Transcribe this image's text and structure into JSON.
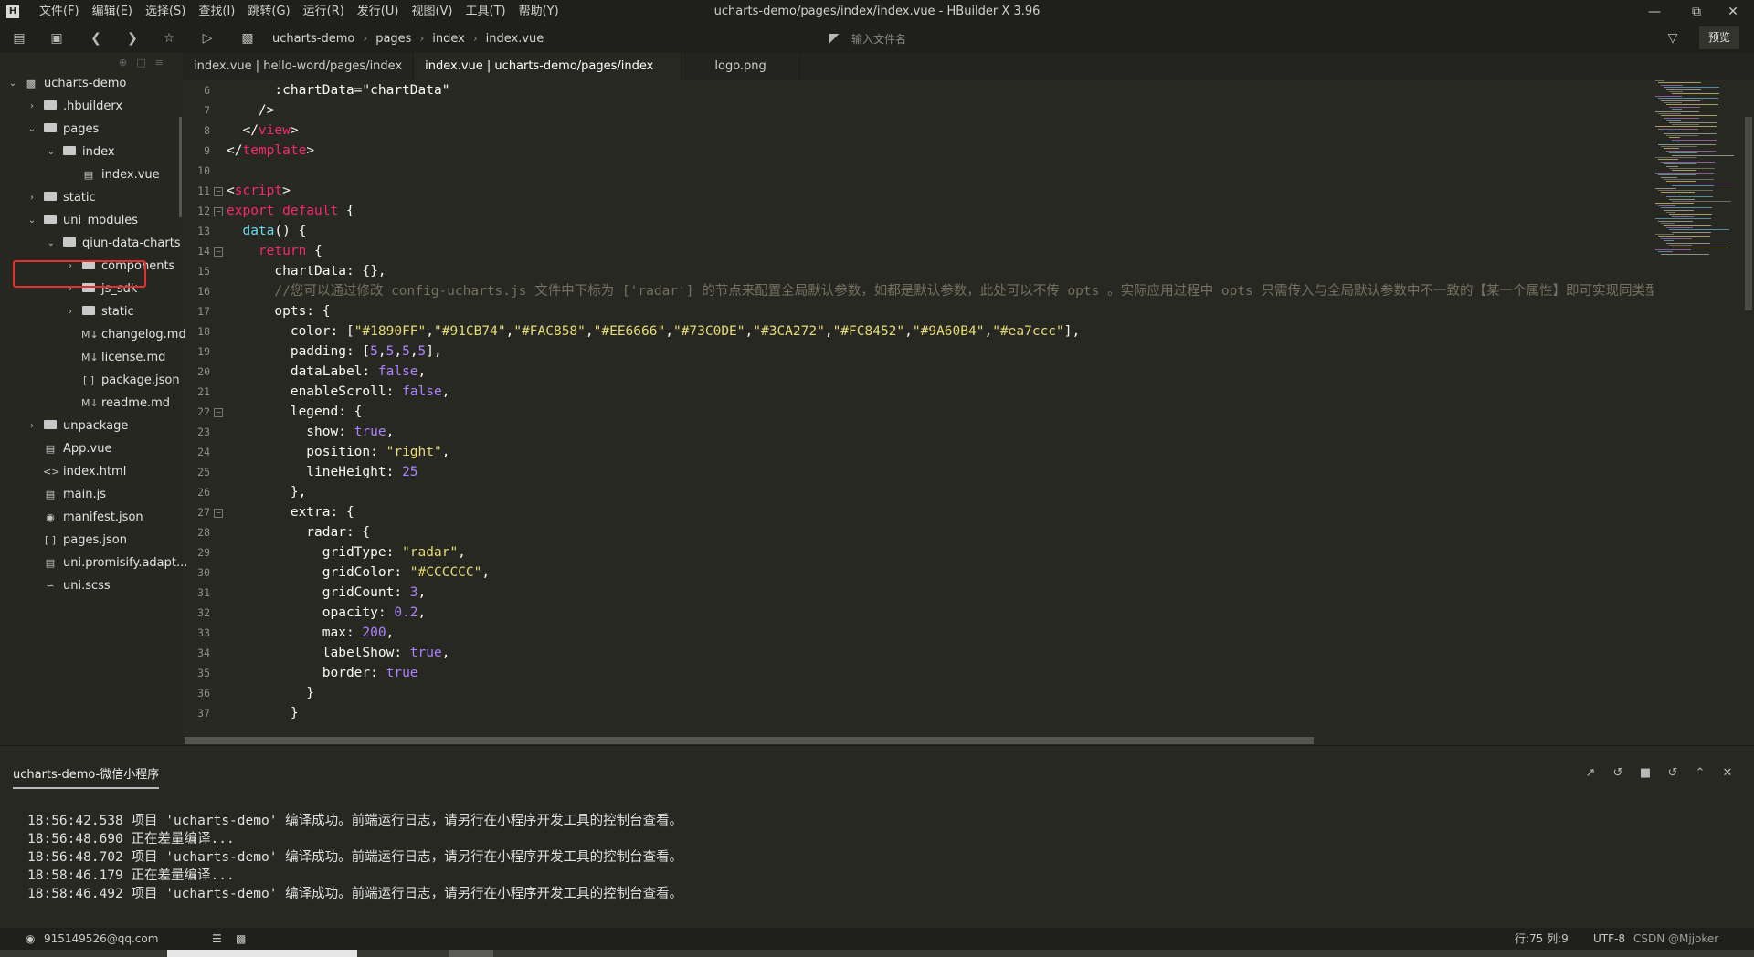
{
  "window": {
    "title": "ucharts-demo/pages/index/index.vue - HBuilder X 3.96",
    "app_logo": "H"
  },
  "menu": [
    "文件(F)",
    "编辑(E)",
    "选择(S)",
    "查找(I)",
    "跳转(G)",
    "运行(R)",
    "发行(U)",
    "视图(V)",
    "工具(T)",
    "帮助(Y)"
  ],
  "breadcrumb": {
    "project": "ucharts-demo",
    "folder": "pages",
    "subfolder": "index",
    "file": "index.vue"
  },
  "search": {
    "placeholder": "输入文件名"
  },
  "preview_label": "预览",
  "tabs": [
    "index.vue | hello-word/pages/index",
    "index.vue | ucharts-demo/pages/index",
    "logo.png"
  ],
  "tree": [
    {
      "label": "ucharts-demo",
      "icon": "project-icon",
      "arrow": "down"
    },
    {
      "label": ".hbuilderx",
      "icon": "folder-icon",
      "arrow": "right"
    },
    {
      "label": "pages",
      "icon": "folder-open-icon",
      "arrow": "down"
    },
    {
      "label": "index",
      "icon": "folder-open-icon",
      "arrow": "down"
    },
    {
      "label": "index.vue",
      "icon": "vue-file-icon",
      "arrow": ""
    },
    {
      "label": "static",
      "icon": "folder-icon",
      "arrow": "right"
    },
    {
      "label": "uni_modules",
      "icon": "folder-open-icon",
      "arrow": "down",
      "highlighted": true
    },
    {
      "label": "qiun-data-charts",
      "icon": "folder-open-icon",
      "arrow": "down"
    },
    {
      "label": "components",
      "icon": "folder-icon",
      "arrow": "right"
    },
    {
      "label": "js_sdk",
      "icon": "folder-icon",
      "arrow": "right"
    },
    {
      "label": "static",
      "icon": "folder-icon",
      "arrow": "right"
    },
    {
      "label": "changelog.md",
      "icon": "markdown-icon",
      "arrow": ""
    },
    {
      "label": "license.md",
      "icon": "markdown-icon",
      "arrow": ""
    },
    {
      "label": "package.json",
      "icon": "json-icon",
      "arrow": ""
    },
    {
      "label": "readme.md",
      "icon": "markdown-icon",
      "arrow": ""
    },
    {
      "label": "unpackage",
      "icon": "folder-icon",
      "arrow": "right"
    },
    {
      "label": "App.vue",
      "icon": "vue-file-icon",
      "arrow": ""
    },
    {
      "label": "index.html",
      "icon": "html-file-icon",
      "arrow": ""
    },
    {
      "label": "main.js",
      "icon": "js-file-icon",
      "arrow": ""
    },
    {
      "label": "manifest.json",
      "icon": "manifest-icon",
      "arrow": ""
    },
    {
      "label": "pages.json",
      "icon": "json-icon",
      "arrow": ""
    },
    {
      "label": "uni.promisify.adapt...",
      "icon": "js-file-icon",
      "arrow": ""
    },
    {
      "label": "uni.scss",
      "icon": "scss-file-icon",
      "arrow": ""
    }
  ],
  "editor": {
    "line_numbers": [
      "6",
      "7",
      "8",
      "9",
      "10",
      "11",
      "12",
      "13",
      "14",
      "15",
      "16",
      "17",
      "18",
      "19",
      "20",
      "21",
      "22",
      "23",
      "24",
      "25",
      "26",
      "27",
      "28",
      "29",
      "30",
      "31",
      "32",
      "33",
      "34",
      "35",
      "36",
      "37"
    ],
    "lines": [
      [
        [
          "",
          "      :chartData=\"chartData\""
        ]
      ],
      [
        [
          "",
          "    />"
        ]
      ],
      [
        [
          "",
          "  </"
        ],
        [
          "tg",
          "view"
        ],
        [
          "",
          ">"
        ]
      ],
      [
        [
          "",
          "</"
        ],
        [
          "tg",
          "template"
        ],
        [
          "",
          ">"
        ]
      ],
      [],
      [
        [
          "",
          "<"
        ],
        [
          "tg",
          "script"
        ],
        [
          "",
          ">"
        ]
      ],
      [
        [
          "k",
          "export default"
        ],
        [
          "",
          " {"
        ]
      ],
      [
        [
          "",
          "  "
        ],
        [
          "p",
          "data"
        ],
        [
          "",
          "() {"
        ]
      ],
      [
        [
          "",
          "    "
        ],
        [
          "k",
          "return"
        ],
        [
          "",
          " {"
        ]
      ],
      [
        [
          "",
          "      chartData: {},"
        ]
      ],
      [
        [
          "c",
          "      //您可以通过修改 config-ucharts.js 文件中下标为 ['radar'] 的节点来配置全局默认参数，如都是默认参数，此处可以不传 opts 。实际应用过程中 opts 只需传入与全局默认参数中不一致的【某一个属性】即可实现同类型的图表显示不同的样式，达到页面简洁的需求。"
        ]
      ],
      [
        [
          "",
          "      opts: {"
        ]
      ],
      [
        [
          "",
          "        color: ["
        ],
        [
          "s",
          "\"#1890FF\""
        ],
        [
          "",
          ","
        ],
        [
          "s",
          "\"#91CB74\""
        ],
        [
          "",
          ","
        ],
        [
          "s",
          "\"#FAC858\""
        ],
        [
          "",
          ","
        ],
        [
          "s",
          "\"#EE6666\""
        ],
        [
          "",
          ","
        ],
        [
          "s",
          "\"#73C0DE\""
        ],
        [
          "",
          ","
        ],
        [
          "s",
          "\"#3CA272\""
        ],
        [
          "",
          ","
        ],
        [
          "s",
          "\"#FC8452\""
        ],
        [
          "",
          ","
        ],
        [
          "s",
          "\"#9A60B4\""
        ],
        [
          "",
          ","
        ],
        [
          "s",
          "\"#ea7ccc\""
        ],
        [
          "",
          "],"
        ]
      ],
      [
        [
          "",
          "        padding: ["
        ],
        [
          "n",
          "5"
        ],
        [
          "",
          ","
        ],
        [
          "n",
          "5"
        ],
        [
          "",
          ","
        ],
        [
          "n",
          "5"
        ],
        [
          "",
          ","
        ],
        [
          "n",
          "5"
        ],
        [
          "",
          "],"
        ]
      ],
      [
        [
          "",
          "        dataLabel: "
        ],
        [
          "n",
          "false"
        ],
        [
          "",
          ","
        ]
      ],
      [
        [
          "",
          "        enableScroll: "
        ],
        [
          "n",
          "false"
        ],
        [
          "",
          ","
        ]
      ],
      [
        [
          "",
          "        legend: {"
        ]
      ],
      [
        [
          "",
          "          show: "
        ],
        [
          "n",
          "true"
        ],
        [
          "",
          ","
        ]
      ],
      [
        [
          "",
          "          position: "
        ],
        [
          "s",
          "\"right\""
        ],
        [
          "",
          ","
        ]
      ],
      [
        [
          "",
          "          lineHeight: "
        ],
        [
          "n",
          "25"
        ]
      ],
      [
        [
          "",
          "        },"
        ]
      ],
      [
        [
          "",
          "        extra: {"
        ]
      ],
      [
        [
          "",
          "          radar: {"
        ]
      ],
      [
        [
          "",
          "            gridType: "
        ],
        [
          "s",
          "\"radar\""
        ],
        [
          "",
          ","
        ]
      ],
      [
        [
          "",
          "            gridColor: "
        ],
        [
          "s",
          "\"#CCCCCC\""
        ],
        [
          "",
          ","
        ]
      ],
      [
        [
          "",
          "            gridCount: "
        ],
        [
          "n",
          "3"
        ],
        [
          "",
          ","
        ]
      ],
      [
        [
          "",
          "            opacity: "
        ],
        [
          "n",
          "0.2"
        ],
        [
          "",
          ","
        ]
      ],
      [
        [
          "",
          "            max: "
        ],
        [
          "n",
          "200"
        ],
        [
          "",
          ","
        ]
      ],
      [
        [
          "",
          "            labelShow: "
        ],
        [
          "n",
          "true"
        ],
        [
          "",
          ","
        ]
      ],
      [
        [
          "",
          "            border: "
        ],
        [
          "n",
          "true"
        ]
      ],
      [
        [
          "",
          "          }"
        ]
      ],
      [
        [
          "",
          "        }"
        ]
      ]
    ],
    "folded_lines": [
      "11",
      "12",
      "14",
      "22",
      "27"
    ]
  },
  "console": {
    "tab_label": "ucharts-demo-微信小程序",
    "lines": [
      "18:56:42.538 项目 'ucharts-demo' 编译成功。前端运行日志，请另行在小程序开发工具的控制台查看。",
      "18:56:48.690 正在差量编译...",
      "18:56:48.702 项目 'ucharts-demo' 编译成功。前端运行日志，请另行在小程序开发工具的控制台查看。",
      "18:58:46.179 正在差量编译...",
      "18:58:46.492 项目 'ucharts-demo' 编译成功。前端运行日志，请另行在小程序开发工具的控制台查看。"
    ]
  },
  "status": {
    "account": "915149526@qq.com",
    "position": "行:75  列:9",
    "encoding": "UTF-8",
    "watermark": "CSDN @Mjjoker"
  }
}
